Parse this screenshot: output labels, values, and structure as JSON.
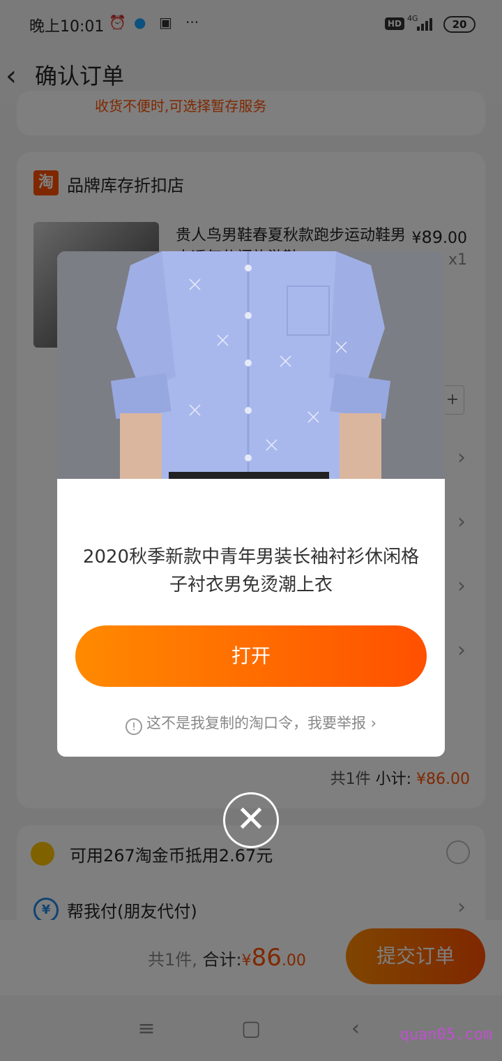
{
  "status_bar": {
    "time": "晚上10:01",
    "icons": [
      "alarm-icon",
      "qq-icon",
      "mi-icon",
      "more-icon"
    ],
    "network": "4G",
    "hd": "HD",
    "battery": "20"
  },
  "header": {
    "title": "确认订单"
  },
  "top_card": {
    "clipped_text": "收货不便时,可选择暂存服务"
  },
  "shop": {
    "logo": "淘",
    "name": "品牌库存折扣店",
    "product": {
      "title": "贵人鸟男鞋春夏秋款跑步运动鞋男士透气休闲旅游鞋",
      "price_symbol": "¥",
      "price_int": "89",
      "price_dec": ".00",
      "qty": "x1"
    },
    "stepper_plus": "+",
    "subtotal_count": "共1件",
    "subtotal_label": "小计:",
    "subtotal_symbol": "¥",
    "subtotal_int": "86",
    "subtotal_dec": ".00"
  },
  "coins": {
    "label": "可用267淘金币抵用2.67元"
  },
  "pay": {
    "icon": "¥",
    "label": "帮我付(朋友代付)"
  },
  "bottom_bar": {
    "count": "共1件,",
    "total_label": "合计:",
    "symbol": "¥",
    "total_int": "86",
    "total_dec": ".00",
    "submit": "提交订单"
  },
  "modal": {
    "title": "2020秋季新款中青年男装长袖衬衫休闲格子衬衣男免烫潮上衣",
    "open_button": "打开",
    "report_text": "这不是我复制的淘口令，我要举报",
    "report_chevron": "›",
    "info_icon": "!",
    "close_icon": "✕"
  },
  "nav": {
    "menu": "≡",
    "home": "▢",
    "back": "‹"
  },
  "watermark": "quan05.com",
  "colors": {
    "accent": "#ff5000",
    "accent_gradient_start": "#ff8a00",
    "shirt": "#a9b8ec"
  }
}
